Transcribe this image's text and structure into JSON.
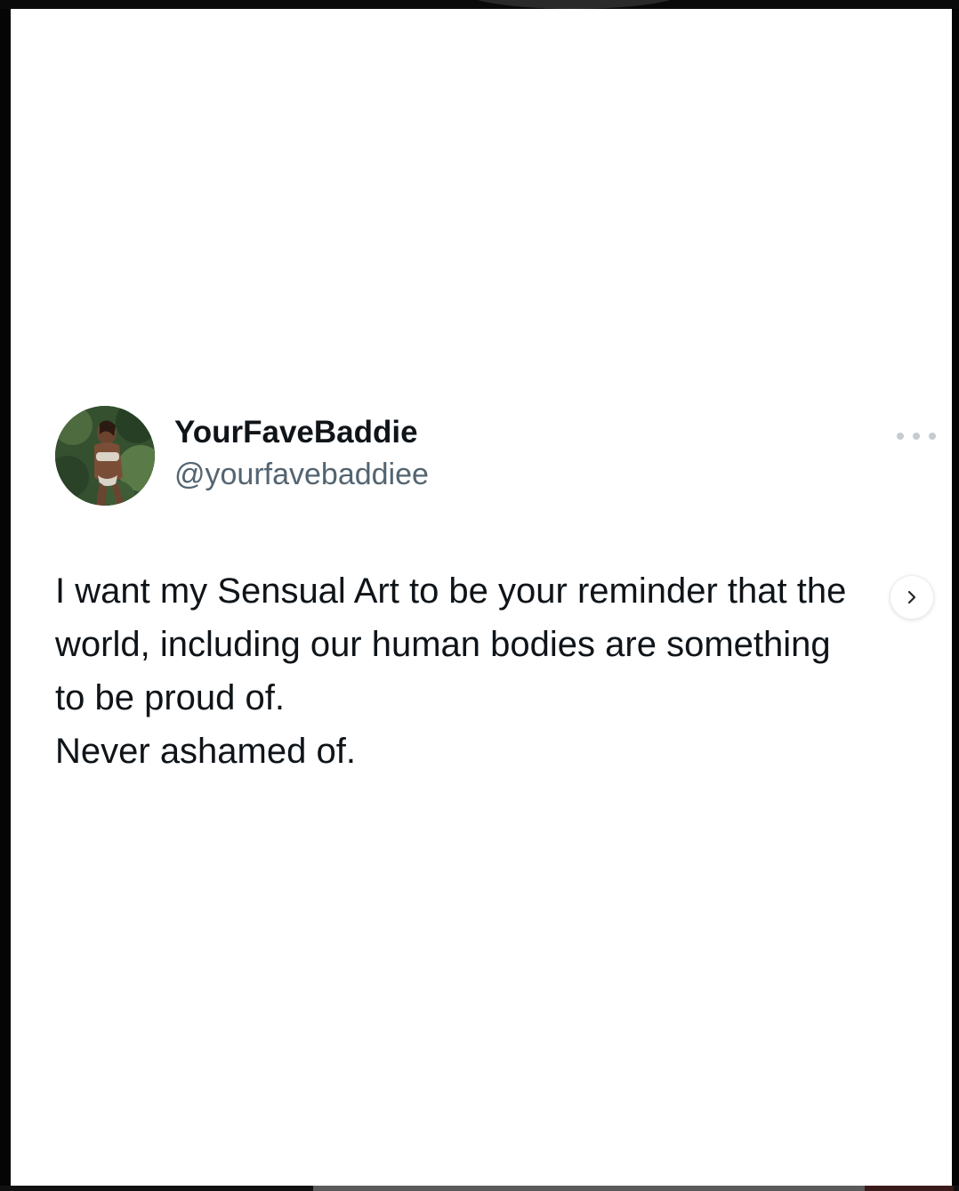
{
  "tweet": {
    "display_name": "YourFaveBaddie",
    "handle": "@yourfavebaddiee",
    "lines": [
      "I want my Sensual Art to be your reminder that the",
      "world, including our human bodies are something",
      "to be proud of.",
      "Never ashamed of."
    ]
  },
  "icons": {
    "more": "more-horizontal-icon",
    "next": "chevron-right-icon"
  },
  "colors": {
    "text_primary": "#0f1419",
    "text_secondary": "#536471",
    "more_dots": "#c7ccd1",
    "card_background": "#ffffff"
  }
}
